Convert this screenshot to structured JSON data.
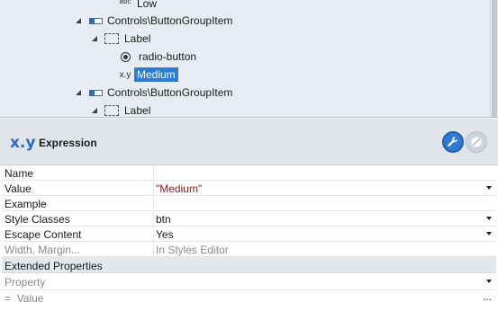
{
  "tree": {
    "nodes": [
      {
        "kind": "text",
        "icon": "abc-text-icon",
        "icon_text": "abc",
        "label": "Low"
      },
      {
        "kind": "button-group-item",
        "icon": "button-group-item-icon",
        "label": "Controls\\ButtonGroupItem"
      },
      {
        "kind": "label",
        "icon": "label-container-icon",
        "label": "Label"
      },
      {
        "kind": "radio",
        "icon": "radio-button-icon",
        "label": "radio-button"
      },
      {
        "kind": "expression",
        "icon": "expression-icon",
        "icon_text": "x.y",
        "label": "Medium",
        "selected": true
      },
      {
        "kind": "button-group-item",
        "icon": "button-group-item-icon",
        "label": "Controls\\ButtonGroupItem"
      },
      {
        "kind": "label",
        "icon": "label-container-icon",
        "label": "Label"
      }
    ]
  },
  "header": {
    "icon_text": "x.y",
    "title": "Expression",
    "accent": "#2e7bd6"
  },
  "properties": {
    "rows": [
      {
        "name": "Name",
        "value": ""
      },
      {
        "name": "Value",
        "value": "\"Medium\""
      },
      {
        "name": "Example",
        "value": ""
      },
      {
        "name": "Style Classes",
        "value": "btn"
      },
      {
        "name": "Escape Content",
        "value": "Yes"
      },
      {
        "name": "Width, Margin...",
        "value": "In Styles Editor"
      }
    ],
    "extended": {
      "title": "Extended Properties",
      "property_placeholder": "Property",
      "value_prefix": "=",
      "value_placeholder": "Value",
      "more": "..."
    }
  }
}
